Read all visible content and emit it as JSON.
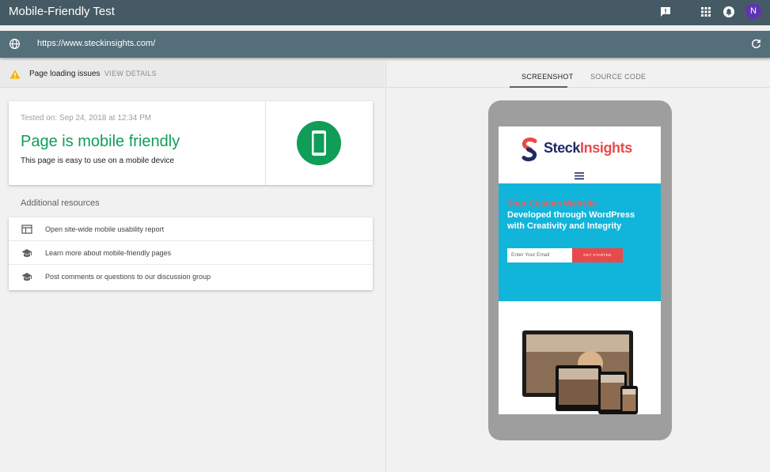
{
  "app": {
    "title": "Mobile-Friendly Test",
    "avatar_initial": "N",
    "icons": [
      "feedback-icon",
      "apps-grid-icon",
      "notifications-icon"
    ]
  },
  "urlbar": {
    "url": "https://www.steckinsights.com/",
    "icons": [
      "globe-icon",
      "refresh-icon"
    ]
  },
  "issues": {
    "label": "Page loading issues",
    "link": "VIEW DETAILS",
    "icon": "warning-icon",
    "icon_color": "#f4b400"
  },
  "result": {
    "tested_on": "Tested on: Sep 24, 2018 at 12:34 PM",
    "verdict": "Page is mobile friendly",
    "description": "This page is easy to use on a mobile device",
    "status_color": "#0f9d58",
    "icon": "mobile-phone-icon"
  },
  "resources": {
    "title": "Additional resources",
    "items": [
      {
        "label": "Open site-wide mobile usability report",
        "icon": "web-page-icon"
      },
      {
        "label": "Learn more about mobile-friendly pages",
        "icon": "graduation-cap-icon"
      },
      {
        "label": "Post comments or questions to our discussion group",
        "icon": "graduation-cap-icon"
      }
    ]
  },
  "tabs": [
    {
      "label": "SCREENSHOT",
      "active": true
    },
    {
      "label": "SOURCE CODE",
      "active": false
    }
  ],
  "preview": {
    "logo_part1": "Steck",
    "logo_part2": "Insights",
    "hero_line1": "Your Custom Website",
    "hero_line2": "Developed through WordPress",
    "hero_line3": "with Creativity and Integrity",
    "email_placeholder": "Enter Your Email",
    "cta": "GET STARTED",
    "hero_color": "#11b5da",
    "accent_color": "#e84a4a"
  }
}
